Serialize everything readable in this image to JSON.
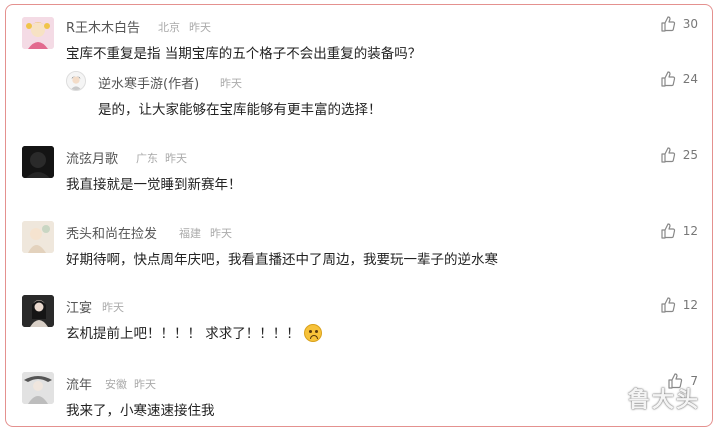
{
  "comments": [
    {
      "name": "R王木木白告",
      "location": "北京",
      "time": "昨天",
      "text": "宝库不重复是指 当期宝库的五个格子不会出重复的装备吗？",
      "likes": "30",
      "avatar_color": "#e8b4c8",
      "reply": {
        "name": "逆水寒手游(作者)",
        "time": "昨天",
        "text": "是的，让大家能够在宝库能够有更丰富的选择！",
        "likes": "24"
      }
    },
    {
      "name": "流弦月歌",
      "location": "广东",
      "time": "昨天",
      "text": "我直接就是一觉睡到新赛年！",
      "likes": "25",
      "avatar_color": "#1a1a1a"
    },
    {
      "name": "秃头和尚在捡发",
      "location": "福建",
      "time": "昨天",
      "text": "好期待啊，快点周年庆吧，我看直播还中了周边，我要玩一辈子的逆水寒",
      "likes": "12",
      "avatar_color": "#e9dfd2"
    },
    {
      "name": "江宴",
      "location": "",
      "time": "昨天",
      "text": "玄机提前上吧！！！！ 求求了！！！！",
      "likes": "12",
      "avatar_color": "#2b2b2b",
      "emoji": "crying-face-icon"
    },
    {
      "name": "流年",
      "location": "安徽",
      "time": "昨天",
      "text": "我来了，小寒速速接住我",
      "likes": "7",
      "avatar_color": "#d9d9d9"
    }
  ],
  "watermark": "鲁大头",
  "colors": {
    "border": "#e4918f",
    "name": "#555555",
    "meta": "#aaaaaa"
  },
  "icons": {
    "like": "thumbs-up-icon"
  }
}
